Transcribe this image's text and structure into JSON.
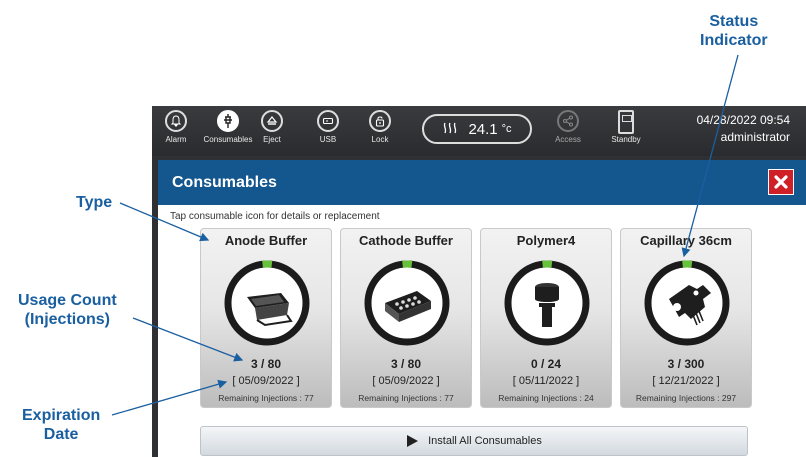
{
  "annotations": {
    "type": "Type",
    "usage_count_line1": "Usage Count",
    "usage_count_line2": "(Injections)",
    "expiration_line1": "Expiration",
    "expiration_line2": "Date",
    "status_line1": "Status",
    "status_line2": "Indicator"
  },
  "toolbar": {
    "buttons": [
      {
        "label": "Alarm",
        "icon": "bell-icon"
      },
      {
        "label": "Consumables",
        "icon": "syringe-icon"
      },
      {
        "label": "Eject",
        "icon": "eject-icon"
      },
      {
        "label": "USB",
        "icon": "usb-icon"
      },
      {
        "label": "Lock",
        "icon": "lock-icon"
      },
      {
        "label": "Access",
        "icon": "share-icon"
      },
      {
        "label": "Standby",
        "icon": "standby-icon"
      }
    ],
    "temperature": {
      "value": "24.1",
      "unit": "°c",
      "icon": "heat-icon"
    },
    "datetime": "04/28/2022 09:54",
    "user": "administrator"
  },
  "panel": {
    "title": "Consumables",
    "instruction": "Tap consumable icon for details or replacement",
    "close_icon": "close-icon"
  },
  "consumables": [
    {
      "name": "Anode Buffer",
      "count": "3 / 80",
      "expiry": "[ 05/09/2022 ]",
      "remaining": "Remaining Injections : 77",
      "used_fraction": 0.0375,
      "icon": "anode-buffer-tray-icon"
    },
    {
      "name": "Cathode Buffer",
      "count": "3 / 80",
      "expiry": "[ 05/09/2022 ]",
      "remaining": "Remaining Injections : 77",
      "used_fraction": 0.0375,
      "icon": "cathode-buffer-tray-icon"
    },
    {
      "name": "Polymer4",
      "count": "0 / 24",
      "expiry": "[ 05/11/2022 ]",
      "remaining": "Remaining Injections : 24",
      "used_fraction": 0,
      "icon": "polymer-bottle-icon"
    },
    {
      "name": "Capillary 36cm",
      "count": "3 / 300",
      "expiry": "[ 12/21/2022 ]",
      "remaining": "Remaining Injections : 297",
      "used_fraction": 0.01,
      "icon": "capillary-array-icon"
    }
  ],
  "install_all": {
    "label": "Install All Consumables",
    "icon": "play-icon"
  },
  "colors": {
    "status_ok": "#66c23a",
    "header_blue": "#14568e",
    "close_red": "#cf2027",
    "callout_blue": "#1a5fa0"
  }
}
